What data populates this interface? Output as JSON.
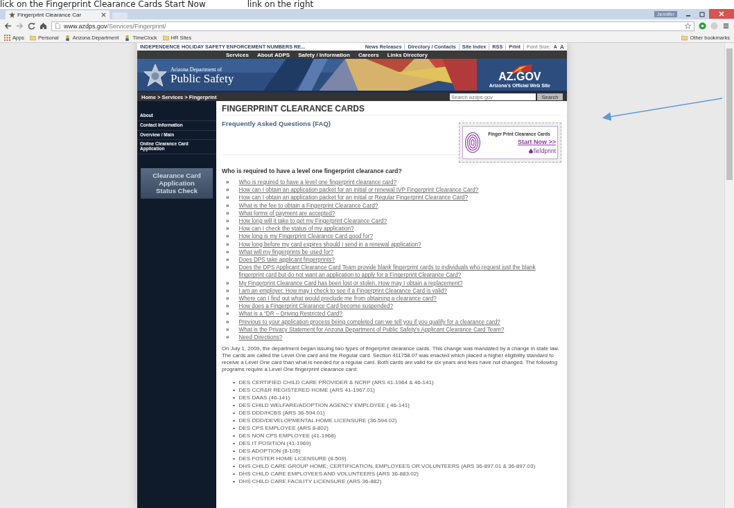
{
  "caption": [
    "lick on the Fingerprint Clearance Cards Start Now",
    "link on the right"
  ],
  "browser": {
    "tab_title": "Fingerprint Clearance Car",
    "url_host": "www.azdps.gov",
    "url_path": "/Services/Fingerprint/",
    "user": "Jennifer",
    "bookmarks": [
      {
        "kind": "apps",
        "label": "Apps"
      },
      {
        "kind": "folder",
        "label": "Personal"
      },
      {
        "kind": "site",
        "label": "Arizona Department"
      },
      {
        "kind": "site",
        "label": "TimeClock"
      },
      {
        "kind": "folder",
        "label": "HR Sites"
      }
    ],
    "other_bookmarks": "Other bookmarks"
  },
  "site": {
    "alert": "INDEPENDENCE HOLIDAY SAFETY ENFORCEMENT NUMBERS RE...",
    "utility_links": [
      "News Releases",
      "Directory / Contacts",
      "Site Index",
      "RSS",
      "Print"
    ],
    "font_size_label": "Font Size:",
    "font_small": "A",
    "font_large": "A",
    "nav": [
      "Services",
      "About ADPS",
      "Safety / Information",
      "Careers",
      "Links Directory"
    ],
    "logo_line1": "Arizona Department of",
    "logo_line2": "Public Safety",
    "azgov": "AZ.GOV",
    "azgov_tagline": "Arizona's Official Web Site",
    "breadcrumb": "Home > Services > Fingerprint",
    "search": {
      "placeholder": "Search azdps.gov"
    },
    "search_button": "Search"
  },
  "sidebar": {
    "items": [
      "About",
      "Contact Information",
      "Overview / Main",
      "Online Clearance Card Application"
    ],
    "status_button": "Clearance Card Application Status Check"
  },
  "main": {
    "title": "FINGERPRINT CLEARANCE CARDS",
    "subtitle": "Frequently Asked Questions (FAQ)",
    "ad": {
      "title": "Finger Print Clearance Cards",
      "cta": "Start Now >>",
      "brand": "fieldprint"
    },
    "question": "Who is required to have a level one fingerprint clearance card?",
    "bullet": "»",
    "faq": [
      "Who is required to have a level one fingerprint clearance card?",
      "How can I obtain an application packet for an initial or renewal IVP Fingerprint Clearance Card?",
      "How can I obtain an application packet for an initial or Regular Fingerprint Clearance Card?",
      "What is the fee to obtain a Fingerprint Clearance Card?",
      "What forms of payment are accepted?",
      "How long will it take to get my Fingerprint Clearance Card?",
      "How can I check the status of my application?",
      "How long is my Fingerprint Clearance Card good for?",
      "How long before my card expires should I send in a renewal application?",
      "What will my fingerprints be used for?",
      "Does DPS take applicant fingerprints?",
      "Does the DPS Applicant Clearance Card Team provide blank fingerprint cards to individuals who request just the blank fingerprint card but do not want an application to apply for a Fingerprint Clearance Card?",
      "My Fingerprint Clearance Card has been lost or stolen. How may I obtain a replacement?",
      "I am an employer. How may I check to see if a Fingerprint Clearance Card is valid?",
      "Where can I find out what would preclude me from obtaining a clearance card?",
      "How does a Fingerprint Clearance Card become suspended?",
      "What is a \"DR – Driving Restricted Card?",
      "Previous to your application process being completed can we tell you if you qualify for a clearance card?",
      "What is the Privacy Statement for Arizona Department of Public Safety's Applicant Clearance Card Team?",
      "Need Directions?"
    ],
    "paragraph": "On July 1, 2009, the department began issuing two types of fingerprint clearance cards.  This change was mandated by a change in state law.  The cards are called the Level One card and the Regular card.  Section 411758.07 was enacted which placed a higher eligibility standard to receive a Level One card than what is needed for a regular card.  Both cards are valid for six years and fees have not changed. The following programs require a Level One fingerprint clearance card:",
    "programs": [
      "DES CERTIFIED CHILD CARE PROVIDER & NCRP (ARS 41-1964 & 46-141)",
      "DES CCR&R REGISTERED HOME (ARS 41-1967.01)",
      "DES DAAS (46-141)",
      "DES CHILD WELFARE/ADOPTION AGENCY EMPLOYEE ( 46-141)",
      "DES DDD/HCBS (ARS 36-594.01)",
      "DES DDD/DEVELOPMENTAL HOME LICENSURE (36-594.02)",
      "DES CPS EMPLOYEE (ARS 8-802)",
      "DES NON CPS EMPLOYEE (41-1968)",
      "DES IT POSITION (41-1969)",
      "DES ADOPTION (8-105)",
      "DES FOSTER HOME LICENSURE (8-509)",
      "DHS CHILD CARE GROUP HOME; CERTIFICATION, EMPLOYEES OR VOLUNTEERS (ARS 36-897.01 & 36-897.03)",
      "DHS CHILD CARE EMPLOYEES AND VOLUNTEERS (ARS 36-883.02)",
      "DHS CHILD CARE FACILITY LICENSURE (ARS 36-882)"
    ]
  }
}
